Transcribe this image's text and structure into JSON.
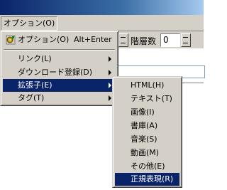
{
  "menubar": {
    "options_label": "オプション(O)"
  },
  "toolbar": {
    "depth_label": "階層数",
    "depth_value": "0"
  },
  "options_menu": {
    "top_item": {
      "label": "オプション(O)",
      "shortcut": "Alt+Enter",
      "icon": "gear-icon"
    },
    "items": [
      {
        "label": "リンク(L)"
      },
      {
        "label": "ダウンロード登録(D)"
      },
      {
        "label": "拡張子(E)"
      },
      {
        "label": "タグ(T)"
      }
    ]
  },
  "extension_submenu": {
    "items": [
      {
        "label": "HTML(H)"
      },
      {
        "label": "テキスト(T)"
      },
      {
        "label": "画像(I)"
      },
      {
        "label": "書庫(A)"
      },
      {
        "label": "音楽(S)"
      },
      {
        "label": "動画(M)"
      },
      {
        "label": "その他(E)"
      },
      {
        "label": "正規表現(R)"
      }
    ]
  },
  "colors": {
    "selection": "#0a246a",
    "menu_face": "#d4d0c8",
    "titlebar": "#0a246a"
  }
}
